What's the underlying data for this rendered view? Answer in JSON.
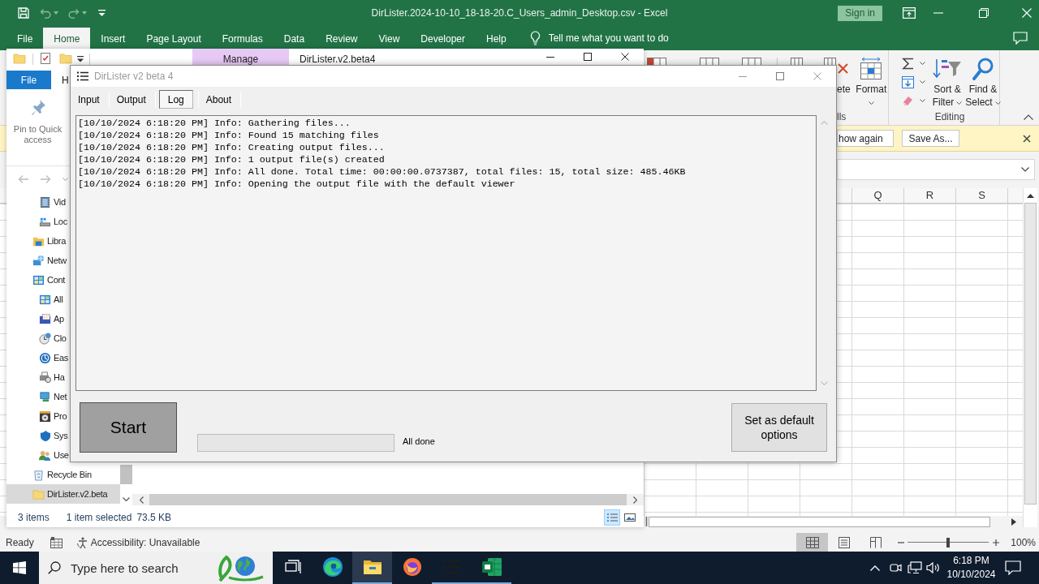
{
  "excel": {
    "quick_access": [
      {
        "kind": "save",
        "disabled": false
      },
      {
        "kind": "undo",
        "disabled": true
      },
      {
        "kind": "redo",
        "disabled": true
      }
    ],
    "title": "DirLister.2024-10-10_18-18-20.C_Users_admin_Desktop.csv - Excel",
    "sign_in": "Sign in",
    "tabs": [
      {
        "label": "File",
        "selected": false
      },
      {
        "label": "Home",
        "selected": true
      },
      {
        "label": "Insert",
        "selected": false
      },
      {
        "label": "Page Layout",
        "selected": false
      },
      {
        "label": "Formulas",
        "selected": false
      },
      {
        "label": "Data",
        "selected": false
      },
      {
        "label": "Review",
        "selected": false
      },
      {
        "label": "View",
        "selected": false
      },
      {
        "label": "Developer",
        "selected": false
      },
      {
        "label": "Help",
        "selected": false
      }
    ],
    "tell_me": "Tell me what you want to do",
    "cells_group": {
      "label": "lls",
      "buttons": [
        {
          "kind": "delete",
          "label": "ete"
        },
        {
          "kind": "format",
          "label": "Format"
        }
      ]
    },
    "editing_group": {
      "label": "Editing",
      "buttons": [
        {
          "kind": "sort",
          "label": "Sort & Filter"
        },
        {
          "kind": "find",
          "label": "Find & Select"
        }
      ]
    },
    "message_bar": {
      "buttons": [
        "how again",
        "Save As..."
      ]
    },
    "columns": [
      "Q",
      "R",
      "S"
    ],
    "status_bar": {
      "mode": "Ready",
      "accessibility": "Accessibility: Unavailable",
      "views": [
        {
          "kind": "normal",
          "selected": true
        },
        {
          "kind": "page-layout",
          "selected": false
        },
        {
          "kind": "page-break",
          "selected": false
        }
      ],
      "zoom_slider": {
        "level": 0.5
      },
      "zoom": "100%"
    }
  },
  "explorer": {
    "context_tab": "Manage",
    "title": "DirLister.v2.beta4",
    "ribbon_tabs": [
      {
        "label": "File",
        "kind": "file"
      },
      {
        "label": "H",
        "kind": "tab"
      }
    ],
    "pin_button": "Pin to Quick access",
    "nav_tree": [
      {
        "children": [
          {
            "label": "Vid",
            "kind": "video",
            "selected": false
          },
          {
            "label": "Loc",
            "kind": "drive",
            "selected": false
          }
        ]
      },
      {
        "label": "Libra",
        "kind": "library",
        "selected": false
      },
      {
        "label": "Netw",
        "kind": "network",
        "selected": false
      },
      {
        "label": "Cont",
        "kind": "control-panel",
        "selected": false,
        "children": [
          {
            "label": "All",
            "kind": "all-items",
            "selected": false
          },
          {
            "label": "Ap",
            "kind": "programs-features",
            "selected": false
          },
          {
            "label": "Clo",
            "kind": "clock",
            "selected": false
          },
          {
            "label": "Eas",
            "kind": "ease",
            "selected": false
          },
          {
            "label": "Ha",
            "kind": "hardware",
            "selected": false
          },
          {
            "label": "Net",
            "kind": "network-center",
            "selected": false
          },
          {
            "label": "Pro",
            "kind": "programs",
            "selected": false
          },
          {
            "label": "Sys",
            "kind": "system",
            "selected": false
          },
          {
            "label": "Use",
            "kind": "users",
            "selected": false
          }
        ]
      },
      {
        "label": "Recycle Bin",
        "kind": "recycle-bin",
        "selected": false
      },
      {
        "label": "DirLister.v2.beta",
        "kind": "folder",
        "selected": true
      }
    ],
    "status": {
      "count": "3 items",
      "selection": "1 item selected",
      "size": "73.5 KB"
    },
    "views": [
      {
        "kind": "details",
        "selected": true
      },
      {
        "kind": "large-icons",
        "selected": false
      }
    ]
  },
  "dirlister": {
    "title": "DirLister v2 beta 4",
    "tabs": [
      {
        "label": "Input",
        "selected": false
      },
      {
        "label": "Output",
        "selected": false
      },
      {
        "label": "Log",
        "selected": true
      },
      {
        "label": "About",
        "selected": false
      }
    ],
    "log": [
      "[10/10/2024 6:18:20 PM] Info: Gathering files...",
      "[10/10/2024 6:18:20 PM] Info: Found 15 matching files",
      "[10/10/2024 6:18:20 PM] Info: Creating output files...",
      "[10/10/2024 6:18:20 PM] Info: 1 output file(s) created",
      "[10/10/2024 6:18:20 PM] Info: All done. Total time: 00:00:00.0737387, total files: 15, total size: 485.46KB",
      "[10/10/2024 6:18:20 PM] Info: Opening the output file with the default viewer"
    ],
    "start": "Start",
    "progress": {
      "level": 0
    },
    "status": "All done",
    "default_button": "Set as default options"
  },
  "taskbar": {
    "search": {
      "placeholder": "Type here to search"
    },
    "apps": [
      {
        "kind": "task-view",
        "selected": false,
        "running": false
      },
      {
        "kind": "edge",
        "selected": false,
        "running": false
      },
      {
        "kind": "explorer",
        "selected": true,
        "running": true
      },
      {
        "kind": "firefox",
        "selected": false,
        "running": false
      },
      {
        "kind": "dirlister",
        "selected": false,
        "running": true
      },
      {
        "kind": "excel",
        "selected": false,
        "running": true
      }
    ],
    "time": "6:18 PM",
    "date": "10/10/2024"
  }
}
